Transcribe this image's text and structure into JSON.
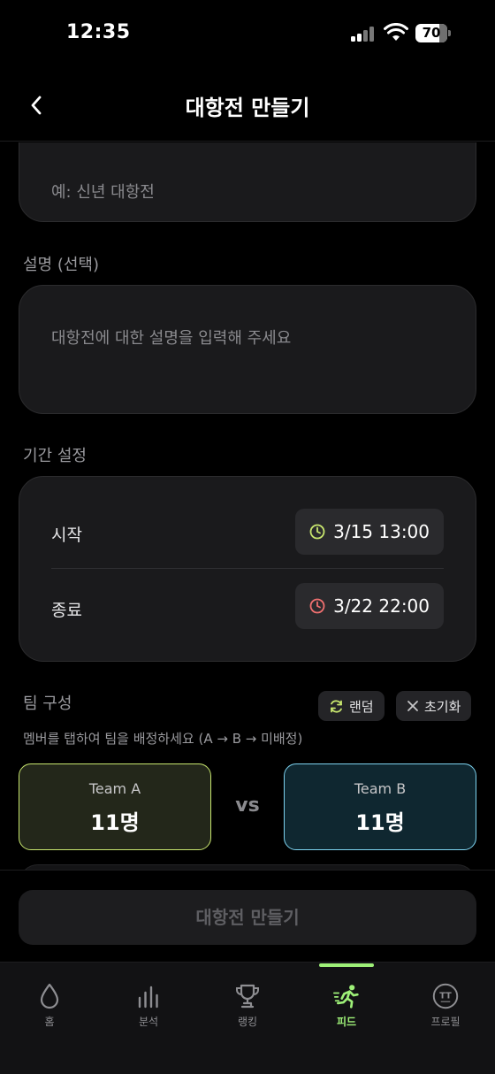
{
  "status_bar": {
    "time": "12:35",
    "battery": "70"
  },
  "header": {
    "title": "대항전 만들기"
  },
  "form": {
    "name_placeholder": "예: 신년 대항전",
    "description_label": "설명 (선택)",
    "description_placeholder": "대항전에 대한 설명을 입력해 주세요",
    "period_label": "기간 설정",
    "start_label": "시작",
    "start_value": "3/15 13:00",
    "end_label": "종료",
    "end_value": "3/22 22:00"
  },
  "team": {
    "label": "팀 구성",
    "random_label": "랜덤",
    "reset_label": "초기화",
    "hint": "멤버를 탭하여 팀을 배정하세요 (A → B → 미배정)",
    "team_a_name": "Team A",
    "team_a_count": "11명",
    "team_b_name": "Team B",
    "team_b_count": "11명",
    "vs": "vs"
  },
  "create_button": "대항전 만들기",
  "tabs": [
    {
      "label": "홈",
      "icon": "drop-icon"
    },
    {
      "label": "분석",
      "icon": "bar-chart-icon"
    },
    {
      "label": "랭킹",
      "icon": "trophy-icon"
    },
    {
      "label": "피드",
      "icon": "runner-icon",
      "active": true
    },
    {
      "label": "프로필",
      "icon": "profile-badge-icon",
      "badge_text": "TT"
    }
  ],
  "colors": {
    "accent_green": "#9ef078",
    "team_a_border": "#c8e66e",
    "team_b_border": "#7dd3f0",
    "start_icon": "#c8e66e",
    "end_icon": "#f07070"
  }
}
